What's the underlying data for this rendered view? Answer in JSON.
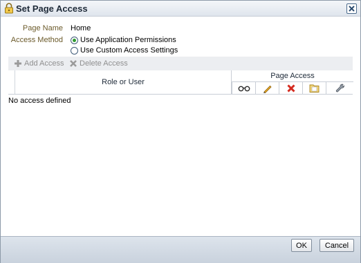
{
  "dialog": {
    "title": "Set Page Access"
  },
  "form": {
    "page_name_label": "Page Name",
    "page_name_value": "Home",
    "access_method_label": "Access Method",
    "options": [
      {
        "label": "Use Application Permissions",
        "selected": true
      },
      {
        "label": "Use Custom Access Settings",
        "selected": false
      }
    ]
  },
  "toolbar": {
    "add_label": "Add Access",
    "delete_label": "Delete Access"
  },
  "table": {
    "role_header": "Role or User",
    "page_access_header": "Page Access",
    "permission_icons": [
      "view-glasses-icon",
      "edit-pencil-icon",
      "delete-x-icon",
      "folder-icon",
      "wrench-icon"
    ],
    "empty_text": "No access defined"
  },
  "footer": {
    "ok_label": "OK",
    "cancel_label": "Cancel"
  },
  "colors": {
    "accent_label": "#6b5a2a",
    "radio_selected": "#2f9a2f",
    "delete_red": "#d42a1f"
  }
}
